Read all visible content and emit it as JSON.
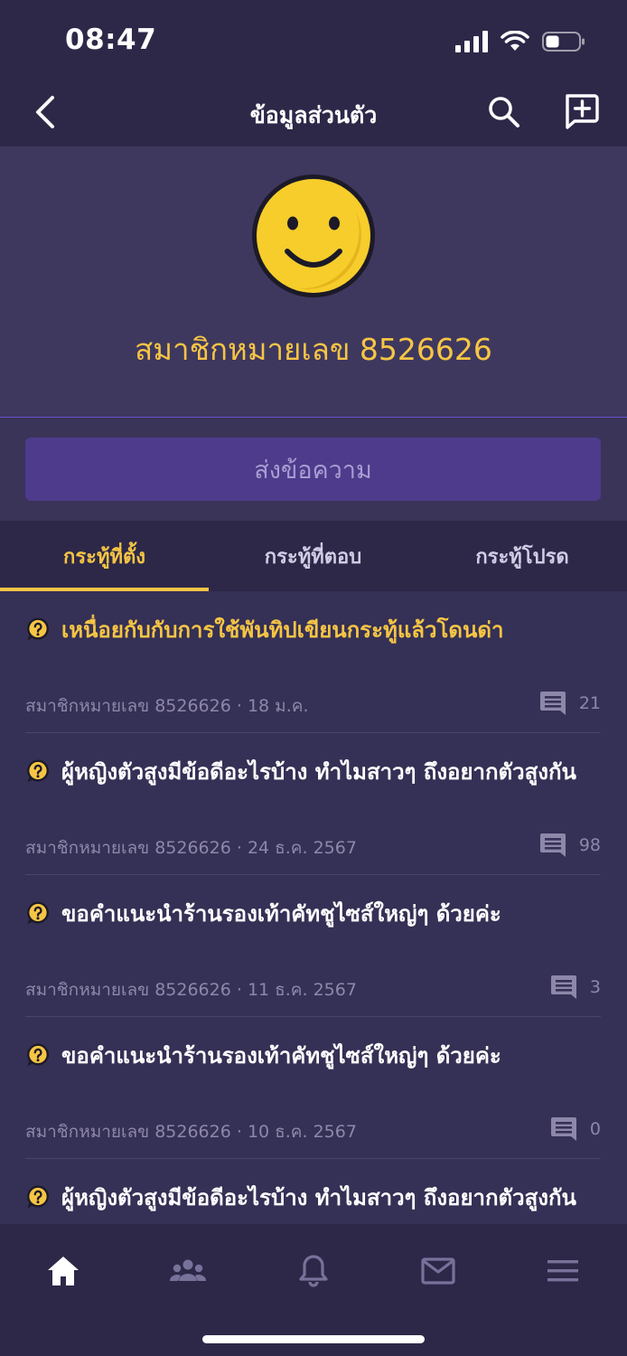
{
  "status_bar": {
    "time": "08:47"
  },
  "header": {
    "title": "ข้อมูลส่วนตัว"
  },
  "profile": {
    "name": "สมาชิกหมายเลข 8526626"
  },
  "message_button": {
    "label": "ส่งข้อความ"
  },
  "tabs": [
    {
      "label": "กระทู้ที่ตั้ง",
      "active": true
    },
    {
      "label": "กระทู้ที่ตอบ",
      "active": false
    },
    {
      "label": "กระทู้โปรด",
      "active": false
    }
  ],
  "topics": [
    {
      "title": "เหนื่อยกับกับการใช้พันทิปเขียนกระทู้แล้วโดนด่า",
      "author": "สมาชิกหมายเลข 8526626",
      "date": "18 ม.ค.",
      "comments": "21"
    },
    {
      "title": "ผู้หญิงตัวสูงมีข้อดีอะไรบ้าง ทำไมสาวๆ ถึงอยากตัวสูงกัน",
      "author": "สมาชิกหมายเลข 8526626",
      "date": "24 ธ.ค. 2567",
      "comments": "98"
    },
    {
      "title": "ขอคำแนะนำร้านรองเท้าคัทชูไซส์ใหญ่ๆ ด้วยค่ะ",
      "author": "สมาชิกหมายเลข 8526626",
      "date": "11 ธ.ค. 2567",
      "comments": "3"
    },
    {
      "title": "ขอคำแนะนำร้านรองเท้าคัทชูไซส์ใหญ่ๆ ด้วยค่ะ",
      "author": "สมาชิกหมายเลข 8526626",
      "date": "10 ธ.ค. 2567",
      "comments": "0"
    },
    {
      "title": "ผู้หญิงตัวสูงมีข้อดีอะไรบ้าง ทำไมสาวๆ ถึงอยากตัวสูงกัน",
      "author": "",
      "date": "",
      "comments": ""
    }
  ],
  "bottom_nav": [
    {
      "icon": "home-icon",
      "active": true
    },
    {
      "icon": "community-icon",
      "active": false
    },
    {
      "icon": "bell-icon",
      "active": false
    },
    {
      "icon": "mail-icon",
      "active": false
    },
    {
      "icon": "menu-icon",
      "active": false
    }
  ],
  "colors": {
    "accent": "#f6c544",
    "background": "#353055",
    "bar": "#2d2848",
    "button": "#4e3b8c"
  }
}
